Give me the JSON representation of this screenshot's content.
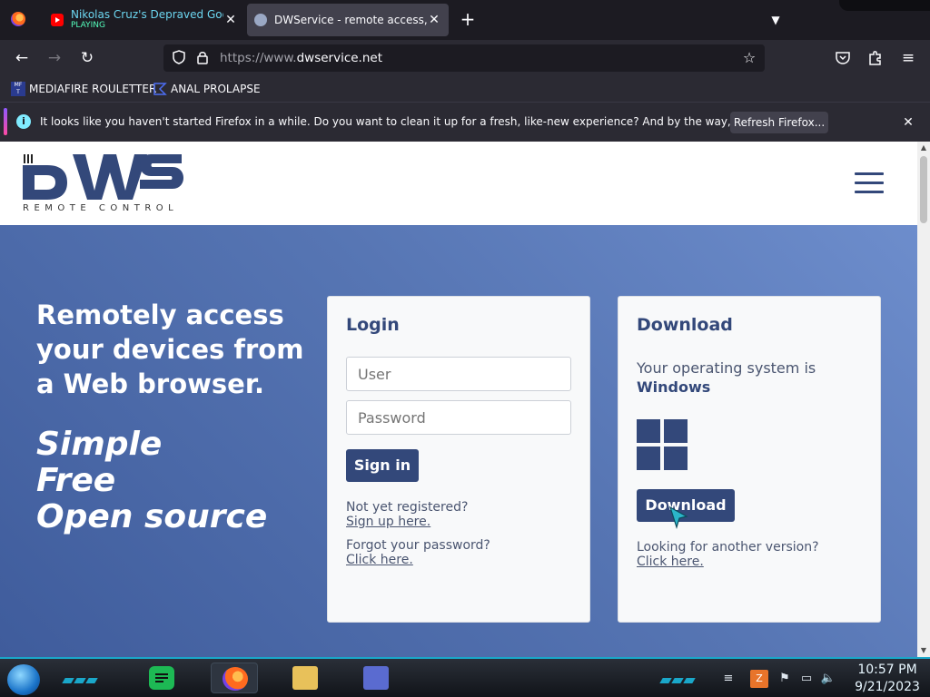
{
  "browser": {
    "tabs": [
      {
        "title": "Nikolas Cruz's Depraved Googl",
        "subtitle": "PLAYING",
        "favicon": "youtube-icon",
        "active": false
      },
      {
        "title": "DWService - remote access, ren",
        "subtitle": "",
        "favicon": "dwservice-gear-icon",
        "active": true
      }
    ],
    "url_scheme": "https://www.",
    "url_host": "dwservice.net",
    "bookmarks": [
      {
        "label": "MEDIAFIRE ROULETTER",
        "icon": "mft-icon"
      },
      {
        "label": "ANAL PROLAPSE",
        "icon": "sigma-icon"
      }
    ],
    "notification": {
      "message": "It looks like you haven't started Firefox in a while. Do you want to clean it up for a fresh, like-new experience? And by the way, welcome back!",
      "button": "Refresh Firefox..."
    }
  },
  "site": {
    "logo_text": "DWS",
    "logo_tagline": "REMOTE CONTROL",
    "hero": {
      "headline": "Remotely access your devices from a Web browser.",
      "slogans": [
        "Simple",
        "Free",
        "Open source"
      ]
    },
    "login": {
      "title": "Login",
      "user_placeholder": "User",
      "password_placeholder": "Password",
      "signin": "Sign in",
      "not_registered": "Not yet registered?",
      "signup_link": "Sign up here.",
      "forgot": "Forgot your password?",
      "forgot_link": "Click here."
    },
    "download": {
      "title": "Download",
      "os_prefix": "Your operating system is",
      "os_name": "Windows",
      "button": "Download",
      "other_version": "Looking for another version?",
      "other_link": "Click here."
    }
  },
  "taskbar": {
    "time": "10:57 PM",
    "date": "9/21/2023"
  },
  "colors": {
    "brand": "#33487a",
    "hero_start": "#3f5c9c",
    "hero_end": "#6d8dcc",
    "taskbar_accent": "#1aa7c9"
  }
}
